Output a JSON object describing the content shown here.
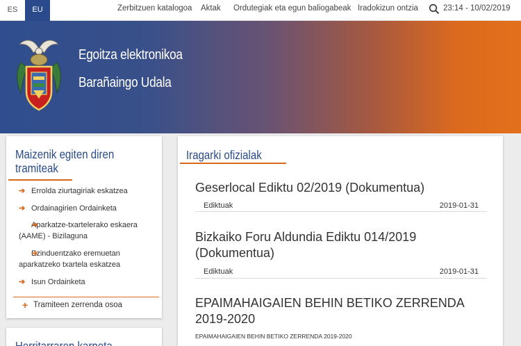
{
  "topbar": {
    "languages": [
      "ES",
      "EU"
    ],
    "nav": [
      "Zerbitzuen katalogoa",
      "Aktak",
      "Ordutegiak eta egun baliogabeak",
      "Iradokizun ontzia"
    ],
    "datetime": "23:14 - 10/02/2019"
  },
  "banner": {
    "title": "Egoitza elektronikoa",
    "subtitle": "Barañaingo Udala"
  },
  "sidebar": {
    "title": "Maizenik egiten diren tramiteak",
    "items": [
      "Errolda ziurtagiriak eskatzea",
      "Ordainagirien Ordainketa",
      "Aparkatze-txartelerako eskaera (AAME) - Bizilaguna",
      "Ezinduentzako eremuetan aparkatzeko txartela eskatzea",
      "Isun Ordainketa"
    ],
    "full_list": "Tramiteen zerrenda osoa",
    "second_title": "Herritarraren karpeta"
  },
  "main": {
    "title": "Iragarki ofizialak",
    "announcements": [
      {
        "title": "Geserlocal Ediktu 02/2019 (Dokumentua)",
        "type": "Ediktuak",
        "date": "2019-01-31"
      },
      {
        "title": "Bizkaiko Foru Aldundia Ediktu 014/2019 (Dokumentua)",
        "type": "Ediktuak",
        "date": "2019-01-31"
      },
      {
        "title": "EPAIMAHAIGAIEN BEHIN BETIKO ZERRENDA 2019-2020",
        "description": "EPAIMAHAIGAIEN BEHIN BETIKO ZERRENDA 2019-2020"
      }
    ]
  },
  "colors": {
    "brand_blue": "#2a4a8c",
    "accent_orange": "#d7691e"
  }
}
